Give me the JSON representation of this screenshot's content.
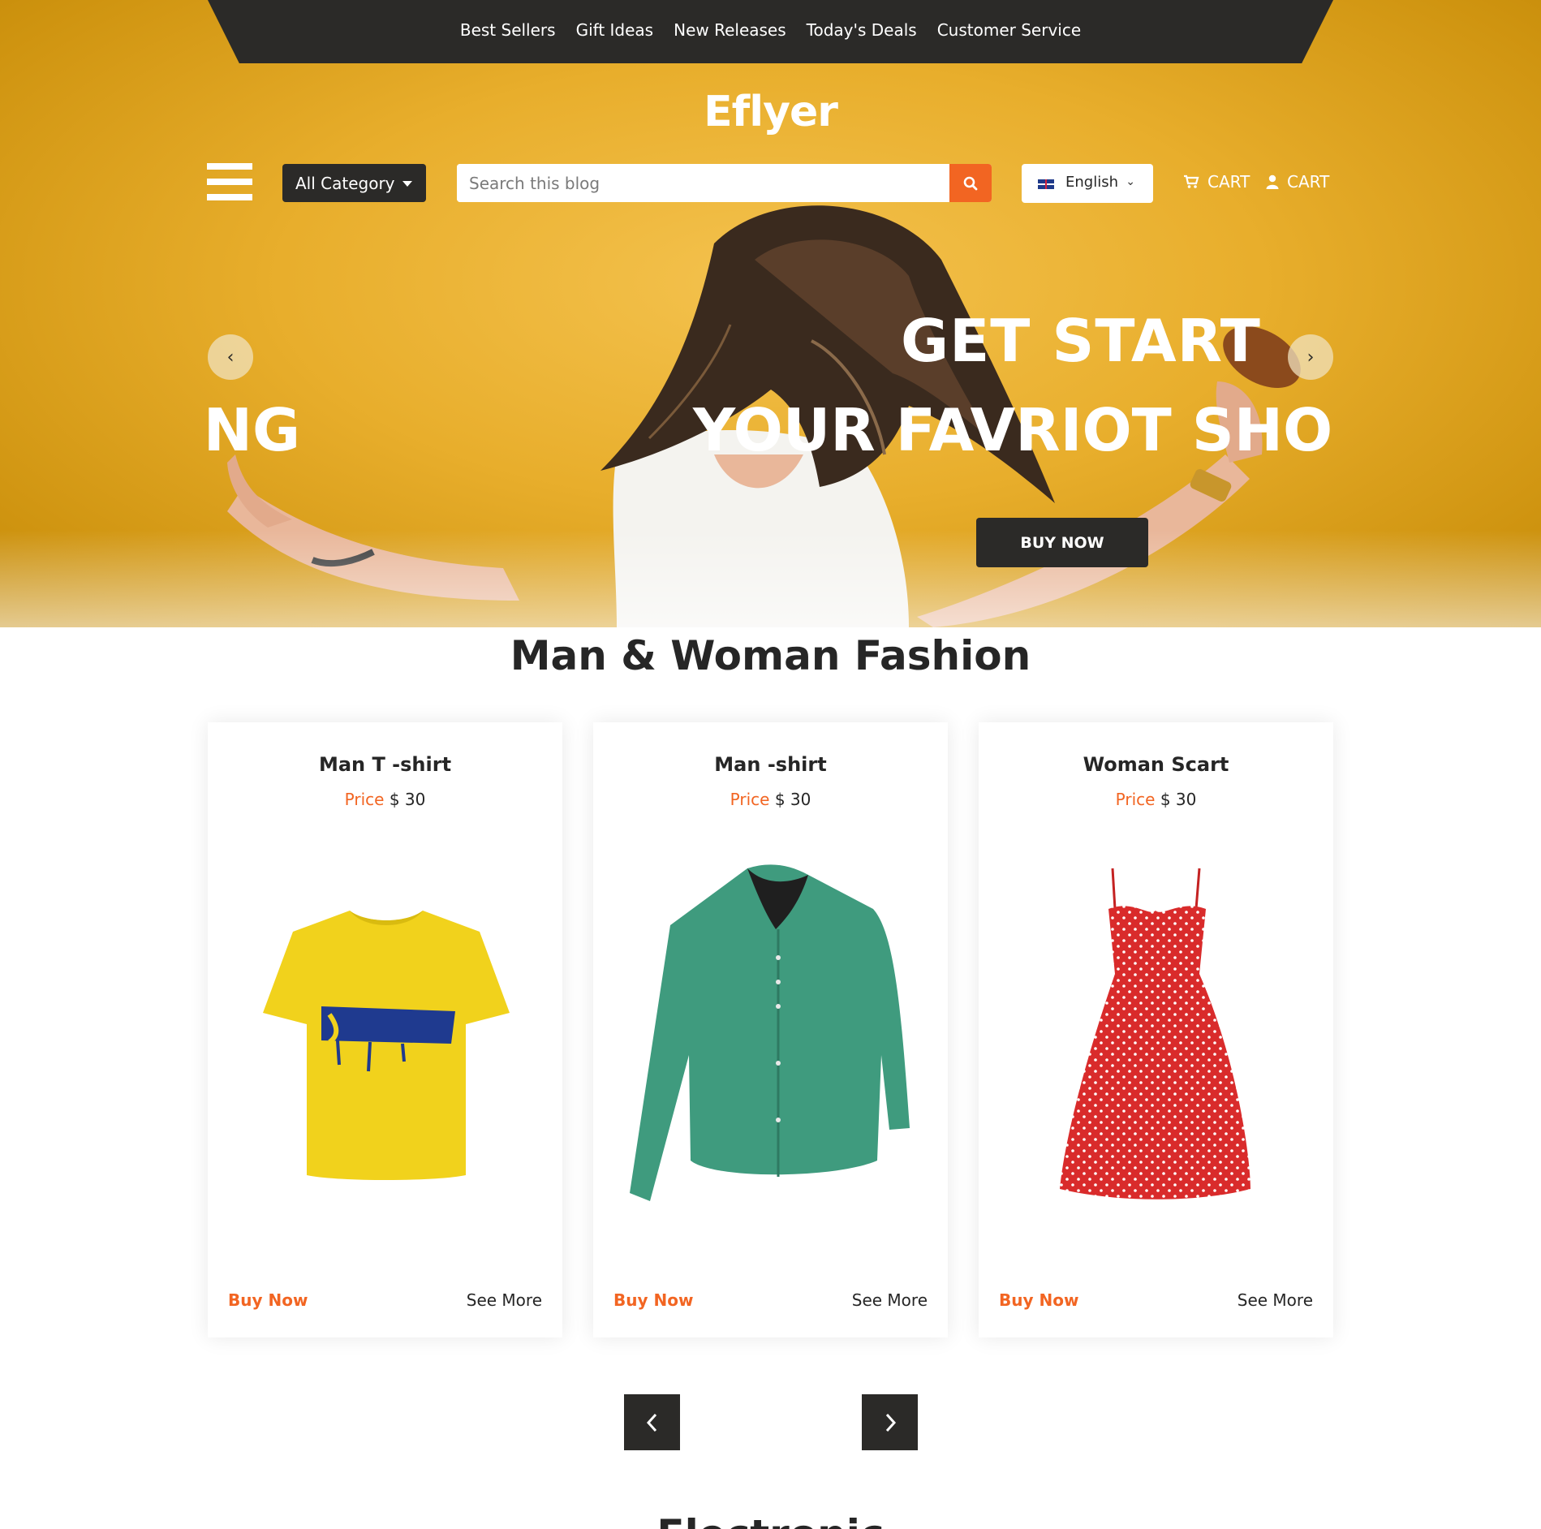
{
  "topnav": {
    "items": [
      "Best Sellers",
      "Gift Ideas",
      "New Releases",
      "Today's Deals",
      "Customer Service"
    ]
  },
  "brand": {
    "logo_text": "Eflyer"
  },
  "toolbar": {
    "category_label": "All Category",
    "search_placeholder": "Search this blog",
    "language_label": "English",
    "cart_label": "CART",
    "account_label": "CART"
  },
  "hero": {
    "line1": "GET START",
    "line2_part_a": "ING",
    "line2_part_b": "YOUR FAVRIOT SHOPI",
    "cta_label": "BUY NOW"
  },
  "fashion": {
    "title": "Man & Woman Fashion",
    "products": [
      {
        "name": "Man T -shirt",
        "price_label": "Price",
        "price": "$ 30",
        "buy_label": "Buy Now",
        "more_label": "See More"
      },
      {
        "name": "Man -shirt",
        "price_label": "Price",
        "price": "$ 30",
        "buy_label": "Buy Now",
        "more_label": "See More"
      },
      {
        "name": "Woman Scart",
        "price_label": "Price",
        "price": "$ 30",
        "buy_label": "Buy Now",
        "more_label": "See More"
      }
    ]
  },
  "next_section": {
    "title": "Electronic"
  },
  "colors": {
    "accent": "#f26522",
    "dark": "#2b2a28",
    "hero_yellow": "#e8ae2c"
  }
}
